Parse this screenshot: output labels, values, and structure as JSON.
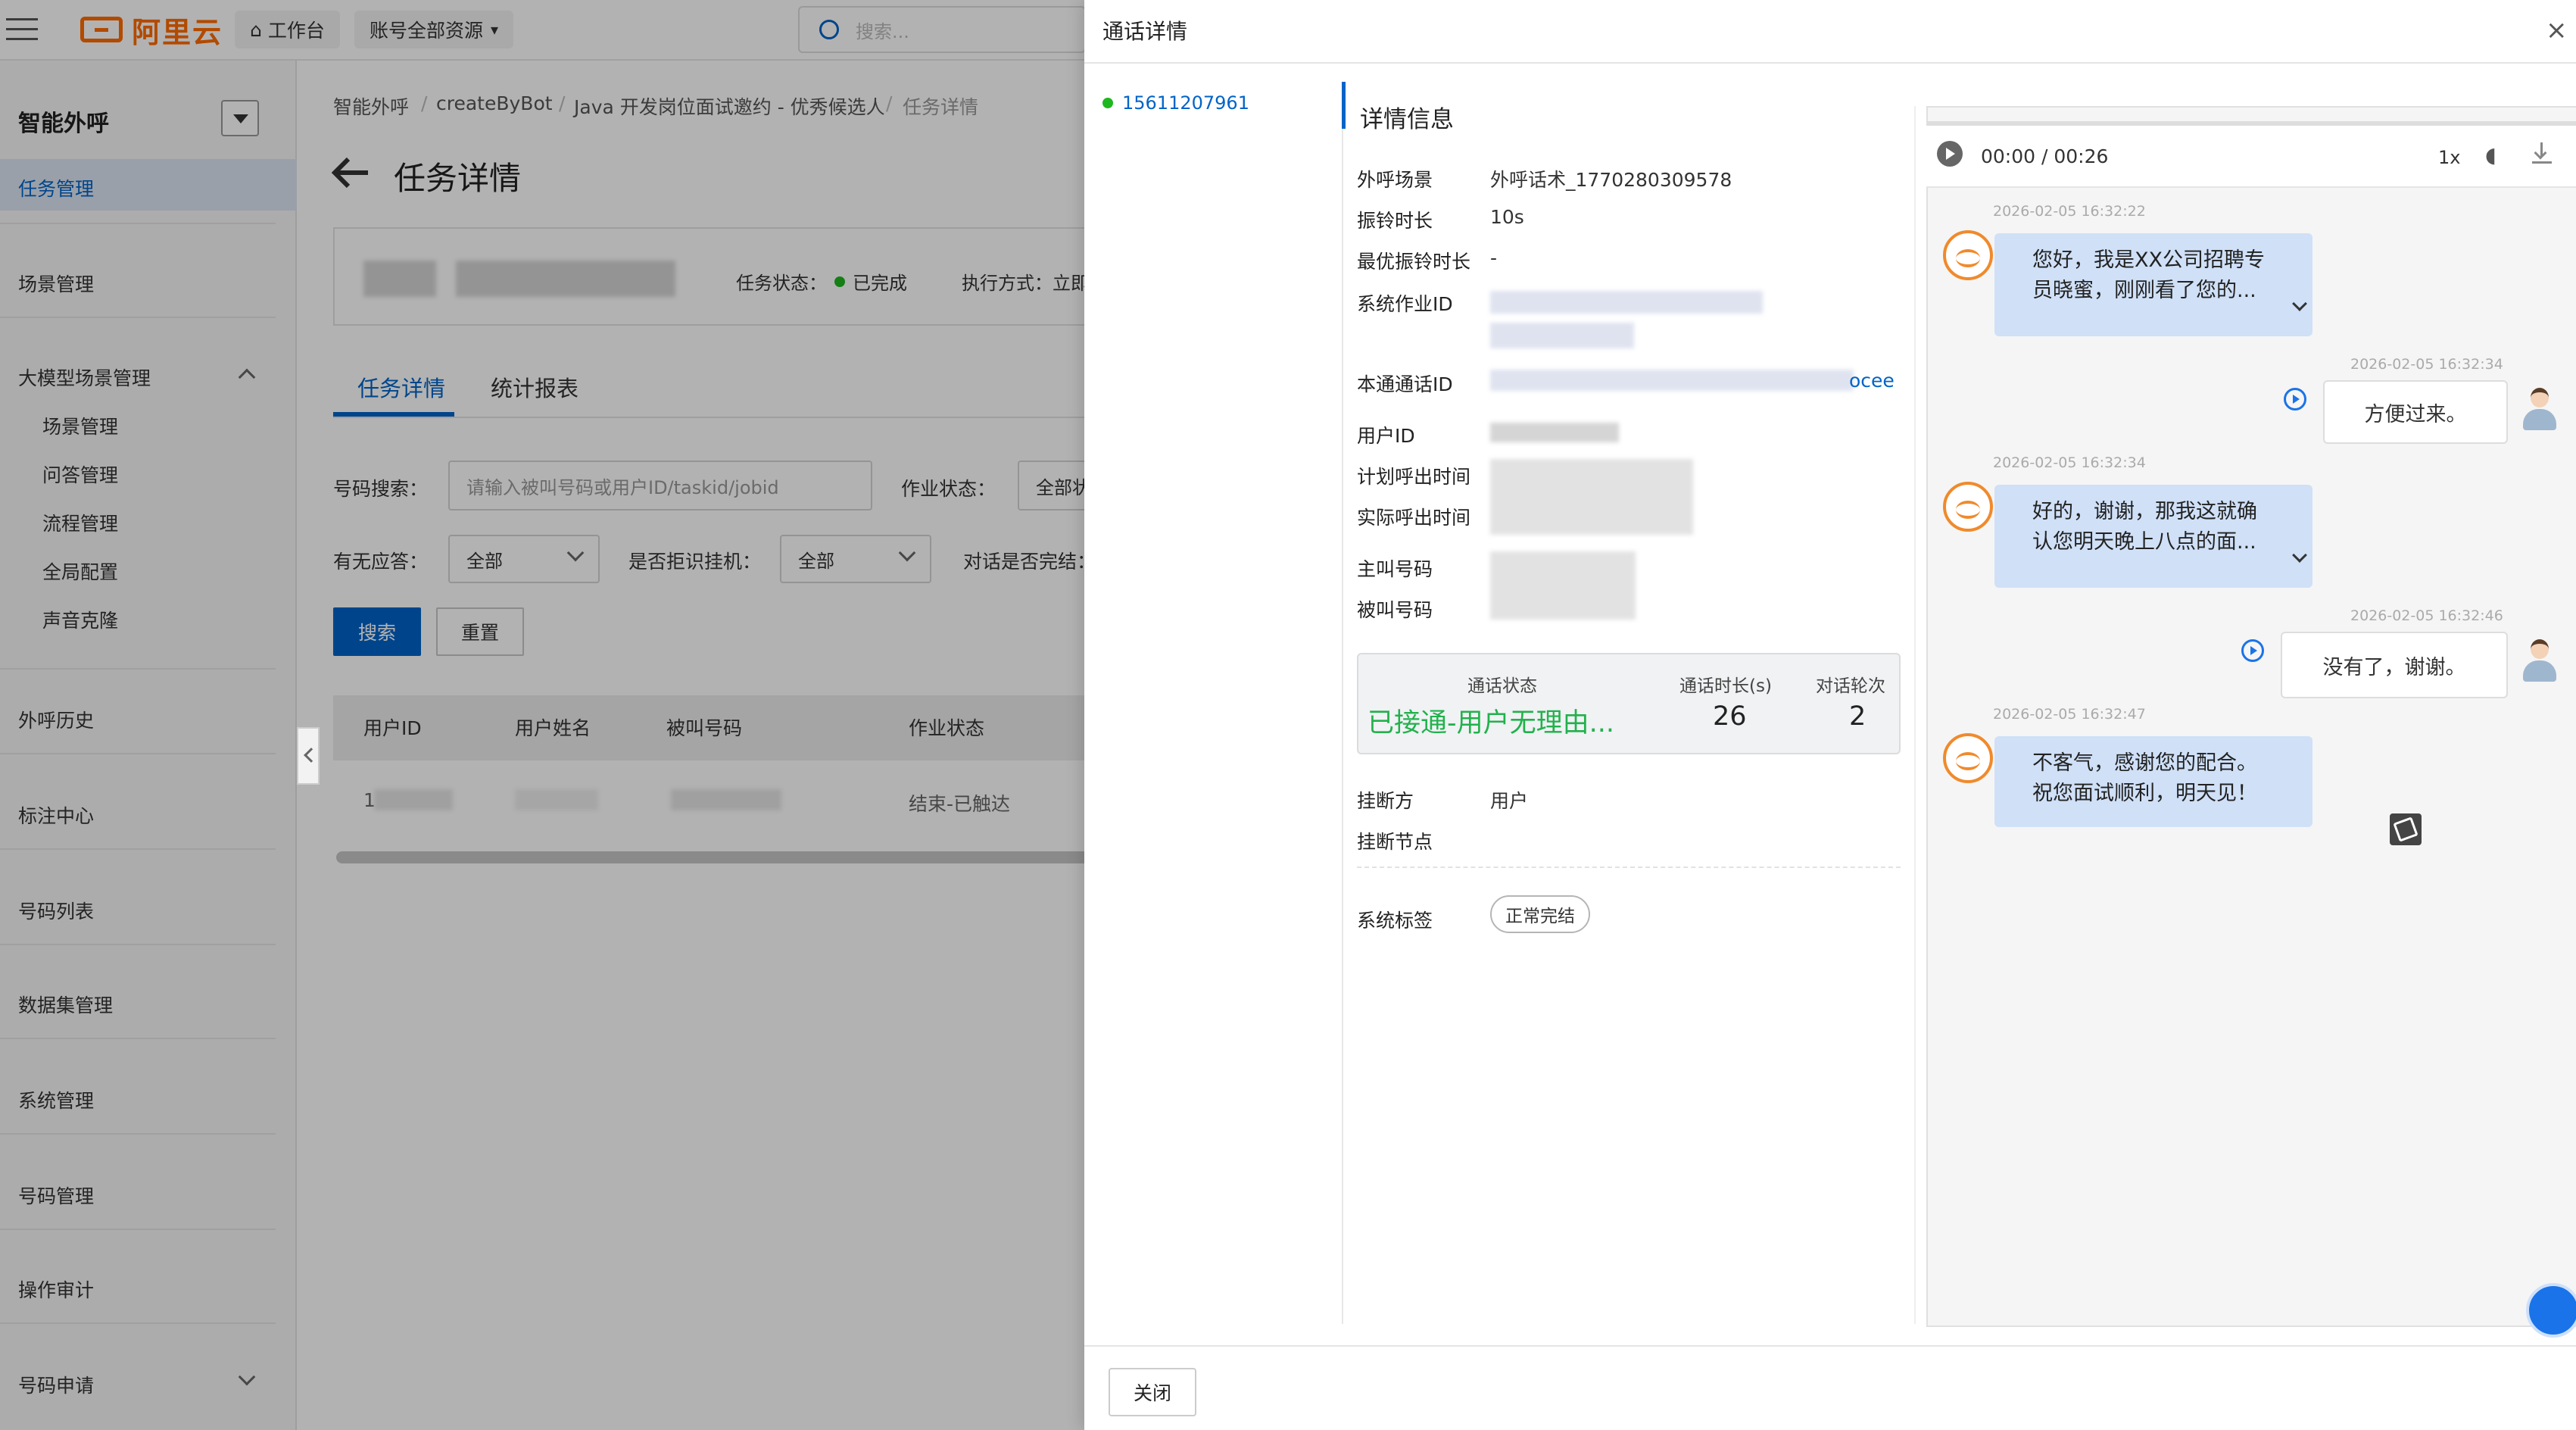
{
  "topbar": {
    "logo_text": "阿里云",
    "workbench_label": "工作台",
    "account_label": "账号全部资源",
    "search_placeholder": "搜索..."
  },
  "sidebar": {
    "title": "智能外呼",
    "items": [
      {
        "label": "任务管理"
      },
      {
        "label": "场景管理"
      },
      {
        "label": "大模型场景管理"
      },
      {
        "label": "外呼历史"
      },
      {
        "label": "标注中心"
      },
      {
        "label": "号码列表"
      },
      {
        "label": "数据集管理"
      },
      {
        "label": "系统管理"
      },
      {
        "label": "号码管理"
      },
      {
        "label": "操作审计"
      },
      {
        "label": "号码申请"
      }
    ],
    "subitems": [
      "场景管理",
      "问答管理",
      "流程管理",
      "全局配置",
      "声音克隆"
    ]
  },
  "main": {
    "breadcrumb": [
      "智能外呼",
      "createByBot",
      "Java 开发岗位面试邀约 - 优秀候选人",
      "任务详情"
    ],
    "title": "任务详情",
    "task_status_label": "任务状态：",
    "task_status_value": "已完成",
    "exec_mode_label": "执行方式：立即",
    "tabs": [
      "任务详情",
      "统计报表"
    ],
    "filters": {
      "number_search_label": "号码搜索：",
      "number_search_placeholder": "请输入被叫号码或用户ID/taskid/jobid",
      "job_status_label": "作业状态：",
      "job_status_value": "全部状",
      "answered_label": "有无应答：",
      "answered_value": "全部",
      "reject_label": "是否拒识挂机：",
      "reject_value": "全部",
      "complete_label": "对话是否完结："
    },
    "search_btn": "搜索",
    "reset_btn": "重置",
    "table": {
      "headers": [
        "用户ID",
        "用户姓名",
        "被叫号码",
        "作业状态"
      ],
      "row": {
        "user_id": "1",
        "status": "结束-已触达"
      }
    }
  },
  "drawer": {
    "title": "通话详情",
    "close_icon": "×",
    "phone": "15611207961",
    "section_title": "详情信息",
    "fields": {
      "scene_label": "外呼场景",
      "scene_value": "外呼话术_1770280309578",
      "ring_label": "振铃时长",
      "ring_value": "10s",
      "best_ring_label": "最优振铃时长",
      "best_ring_value": "-",
      "job_id_label": "系统作业ID",
      "call_id_label": "本通通话ID",
      "call_id_tail": "ocee",
      "user_id_label": "用户ID",
      "plan_time_label": "计划呼出时间",
      "actual_time_label": "实际呼出时间",
      "caller_label": "主叫号码",
      "callee_label": "被叫号码"
    },
    "stats": {
      "status_label": "通话状态",
      "status_value": "已接通-用户无理由...",
      "duration_label": "通话时长(s)",
      "duration_value": "26",
      "rounds_label": "对话轮次",
      "rounds_value": "2"
    },
    "hangup_label": "挂断方",
    "hangup_value": "用户",
    "hangup_node_label": "挂断节点",
    "sys_tag_label": "系统标签",
    "sys_tag_value": "正常完结",
    "audio": {
      "time": "00:00 / 00:26",
      "speed": "1x"
    },
    "messages": [
      {
        "role": "bot",
        "time": "2026-02-05 16:32:22",
        "text": [
          "您好，我是XX公司招聘专",
          "员晓蜜，刚刚看了您的..."
        ]
      },
      {
        "role": "user",
        "time": "2026-02-05 16:32:34",
        "text": [
          "方便过来。"
        ]
      },
      {
        "role": "bot",
        "time": "2026-02-05 16:32:34",
        "text": [
          "好的，谢谢，那我这就确",
          "认您明天晚上八点的面..."
        ]
      },
      {
        "role": "user",
        "time": "2026-02-05 16:32:46",
        "text": [
          "没有了，谢谢。"
        ]
      },
      {
        "role": "bot",
        "time": "2026-02-05 16:32:47",
        "text": [
          "不客气，感谢您的配合。",
          "祝您面试顺利，明天见！"
        ]
      }
    ],
    "close_btn": "关闭"
  },
  "colors": {
    "accent": "#0064c8",
    "brand": "#ff6a00",
    "success": "#1fb71f",
    "status_text": "#22b14c"
  }
}
